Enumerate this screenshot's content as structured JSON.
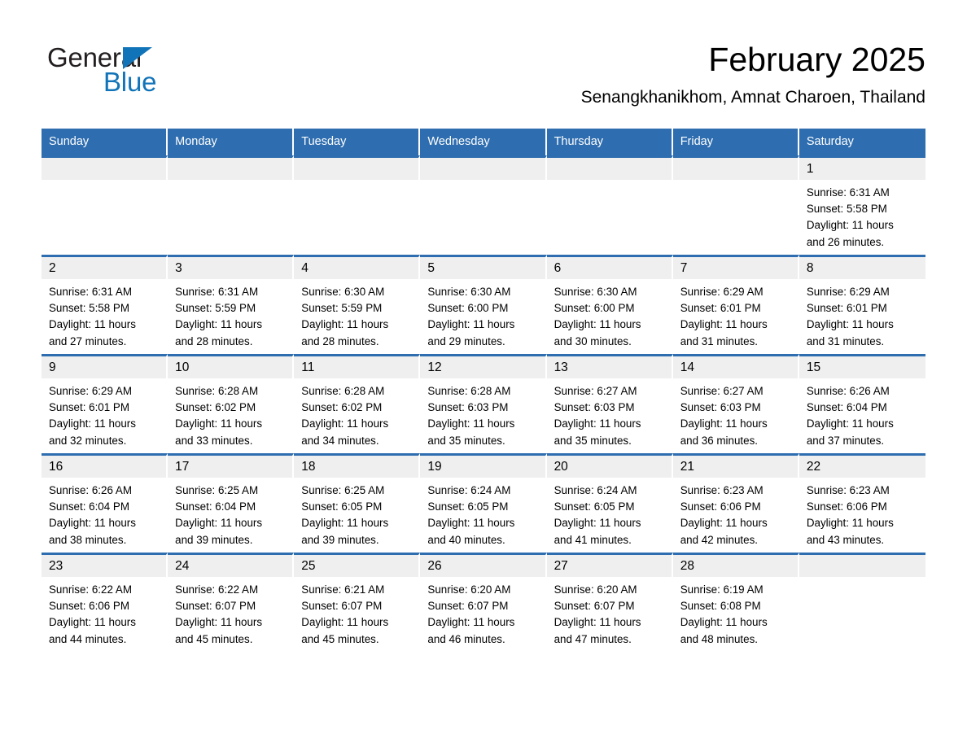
{
  "brand": {
    "name_part1": "General",
    "name_part2": "Blue",
    "triangle_icon": "triangle-icon",
    "accent_color": "#1274b8"
  },
  "header": {
    "title": "February 2025",
    "subtitle": "Senangkhanikhom, Amnat Charoen, Thailand"
  },
  "colors": {
    "header_blue": "#2e6daf",
    "daynum_band": "#efefef",
    "text": "#000000",
    "brand_blue": "#1274b8"
  },
  "calendar": {
    "weekday_headers": [
      "Sunday",
      "Monday",
      "Tuesday",
      "Wednesday",
      "Thursday",
      "Friday",
      "Saturday"
    ],
    "weeks": [
      [
        {
          "day": "",
          "empty": true
        },
        {
          "day": "",
          "empty": true
        },
        {
          "day": "",
          "empty": true
        },
        {
          "day": "",
          "empty": true
        },
        {
          "day": "",
          "empty": true
        },
        {
          "day": "",
          "empty": true
        },
        {
          "day": "1",
          "sunrise": "Sunrise: 6:31 AM",
          "sunset": "Sunset: 5:58 PM",
          "daylight_l1": "Daylight: 11 hours",
          "daylight_l2": "and 26 minutes."
        }
      ],
      [
        {
          "day": "2",
          "sunrise": "Sunrise: 6:31 AM",
          "sunset": "Sunset: 5:58 PM",
          "daylight_l1": "Daylight: 11 hours",
          "daylight_l2": "and 27 minutes."
        },
        {
          "day": "3",
          "sunrise": "Sunrise: 6:31 AM",
          "sunset": "Sunset: 5:59 PM",
          "daylight_l1": "Daylight: 11 hours",
          "daylight_l2": "and 28 minutes."
        },
        {
          "day": "4",
          "sunrise": "Sunrise: 6:30 AM",
          "sunset": "Sunset: 5:59 PM",
          "daylight_l1": "Daylight: 11 hours",
          "daylight_l2": "and 28 minutes."
        },
        {
          "day": "5",
          "sunrise": "Sunrise: 6:30 AM",
          "sunset": "Sunset: 6:00 PM",
          "daylight_l1": "Daylight: 11 hours",
          "daylight_l2": "and 29 minutes."
        },
        {
          "day": "6",
          "sunrise": "Sunrise: 6:30 AM",
          "sunset": "Sunset: 6:00 PM",
          "daylight_l1": "Daylight: 11 hours",
          "daylight_l2": "and 30 minutes."
        },
        {
          "day": "7",
          "sunrise": "Sunrise: 6:29 AM",
          "sunset": "Sunset: 6:01 PM",
          "daylight_l1": "Daylight: 11 hours",
          "daylight_l2": "and 31 minutes."
        },
        {
          "day": "8",
          "sunrise": "Sunrise: 6:29 AM",
          "sunset": "Sunset: 6:01 PM",
          "daylight_l1": "Daylight: 11 hours",
          "daylight_l2": "and 31 minutes."
        }
      ],
      [
        {
          "day": "9",
          "sunrise": "Sunrise: 6:29 AM",
          "sunset": "Sunset: 6:01 PM",
          "daylight_l1": "Daylight: 11 hours",
          "daylight_l2": "and 32 minutes."
        },
        {
          "day": "10",
          "sunrise": "Sunrise: 6:28 AM",
          "sunset": "Sunset: 6:02 PM",
          "daylight_l1": "Daylight: 11 hours",
          "daylight_l2": "and 33 minutes."
        },
        {
          "day": "11",
          "sunrise": "Sunrise: 6:28 AM",
          "sunset": "Sunset: 6:02 PM",
          "daylight_l1": "Daylight: 11 hours",
          "daylight_l2": "and 34 minutes."
        },
        {
          "day": "12",
          "sunrise": "Sunrise: 6:28 AM",
          "sunset": "Sunset: 6:03 PM",
          "daylight_l1": "Daylight: 11 hours",
          "daylight_l2": "and 35 minutes."
        },
        {
          "day": "13",
          "sunrise": "Sunrise: 6:27 AM",
          "sunset": "Sunset: 6:03 PM",
          "daylight_l1": "Daylight: 11 hours",
          "daylight_l2": "and 35 minutes."
        },
        {
          "day": "14",
          "sunrise": "Sunrise: 6:27 AM",
          "sunset": "Sunset: 6:03 PM",
          "daylight_l1": "Daylight: 11 hours",
          "daylight_l2": "and 36 minutes."
        },
        {
          "day": "15",
          "sunrise": "Sunrise: 6:26 AM",
          "sunset": "Sunset: 6:04 PM",
          "daylight_l1": "Daylight: 11 hours",
          "daylight_l2": "and 37 minutes."
        }
      ],
      [
        {
          "day": "16",
          "sunrise": "Sunrise: 6:26 AM",
          "sunset": "Sunset: 6:04 PM",
          "daylight_l1": "Daylight: 11 hours",
          "daylight_l2": "and 38 minutes."
        },
        {
          "day": "17",
          "sunrise": "Sunrise: 6:25 AM",
          "sunset": "Sunset: 6:04 PM",
          "daylight_l1": "Daylight: 11 hours",
          "daylight_l2": "and 39 minutes."
        },
        {
          "day": "18",
          "sunrise": "Sunrise: 6:25 AM",
          "sunset": "Sunset: 6:05 PM",
          "daylight_l1": "Daylight: 11 hours",
          "daylight_l2": "and 39 minutes."
        },
        {
          "day": "19",
          "sunrise": "Sunrise: 6:24 AM",
          "sunset": "Sunset: 6:05 PM",
          "daylight_l1": "Daylight: 11 hours",
          "daylight_l2": "and 40 minutes."
        },
        {
          "day": "20",
          "sunrise": "Sunrise: 6:24 AM",
          "sunset": "Sunset: 6:05 PM",
          "daylight_l1": "Daylight: 11 hours",
          "daylight_l2": "and 41 minutes."
        },
        {
          "day": "21",
          "sunrise": "Sunrise: 6:23 AM",
          "sunset": "Sunset: 6:06 PM",
          "daylight_l1": "Daylight: 11 hours",
          "daylight_l2": "and 42 minutes."
        },
        {
          "day": "22",
          "sunrise": "Sunrise: 6:23 AM",
          "sunset": "Sunset: 6:06 PM",
          "daylight_l1": "Daylight: 11 hours",
          "daylight_l2": "and 43 minutes."
        }
      ],
      [
        {
          "day": "23",
          "sunrise": "Sunrise: 6:22 AM",
          "sunset": "Sunset: 6:06 PM",
          "daylight_l1": "Daylight: 11 hours",
          "daylight_l2": "and 44 minutes."
        },
        {
          "day": "24",
          "sunrise": "Sunrise: 6:22 AM",
          "sunset": "Sunset: 6:07 PM",
          "daylight_l1": "Daylight: 11 hours",
          "daylight_l2": "and 45 minutes."
        },
        {
          "day": "25",
          "sunrise": "Sunrise: 6:21 AM",
          "sunset": "Sunset: 6:07 PM",
          "daylight_l1": "Daylight: 11 hours",
          "daylight_l2": "and 45 minutes."
        },
        {
          "day": "26",
          "sunrise": "Sunrise: 6:20 AM",
          "sunset": "Sunset: 6:07 PM",
          "daylight_l1": "Daylight: 11 hours",
          "daylight_l2": "and 46 minutes."
        },
        {
          "day": "27",
          "sunrise": "Sunrise: 6:20 AM",
          "sunset": "Sunset: 6:07 PM",
          "daylight_l1": "Daylight: 11 hours",
          "daylight_l2": "and 47 minutes."
        },
        {
          "day": "28",
          "sunrise": "Sunrise: 6:19 AM",
          "sunset": "Sunset: 6:08 PM",
          "daylight_l1": "Daylight: 11 hours",
          "daylight_l2": "and 48 minutes."
        },
        {
          "day": "",
          "empty": true
        }
      ]
    ]
  }
}
